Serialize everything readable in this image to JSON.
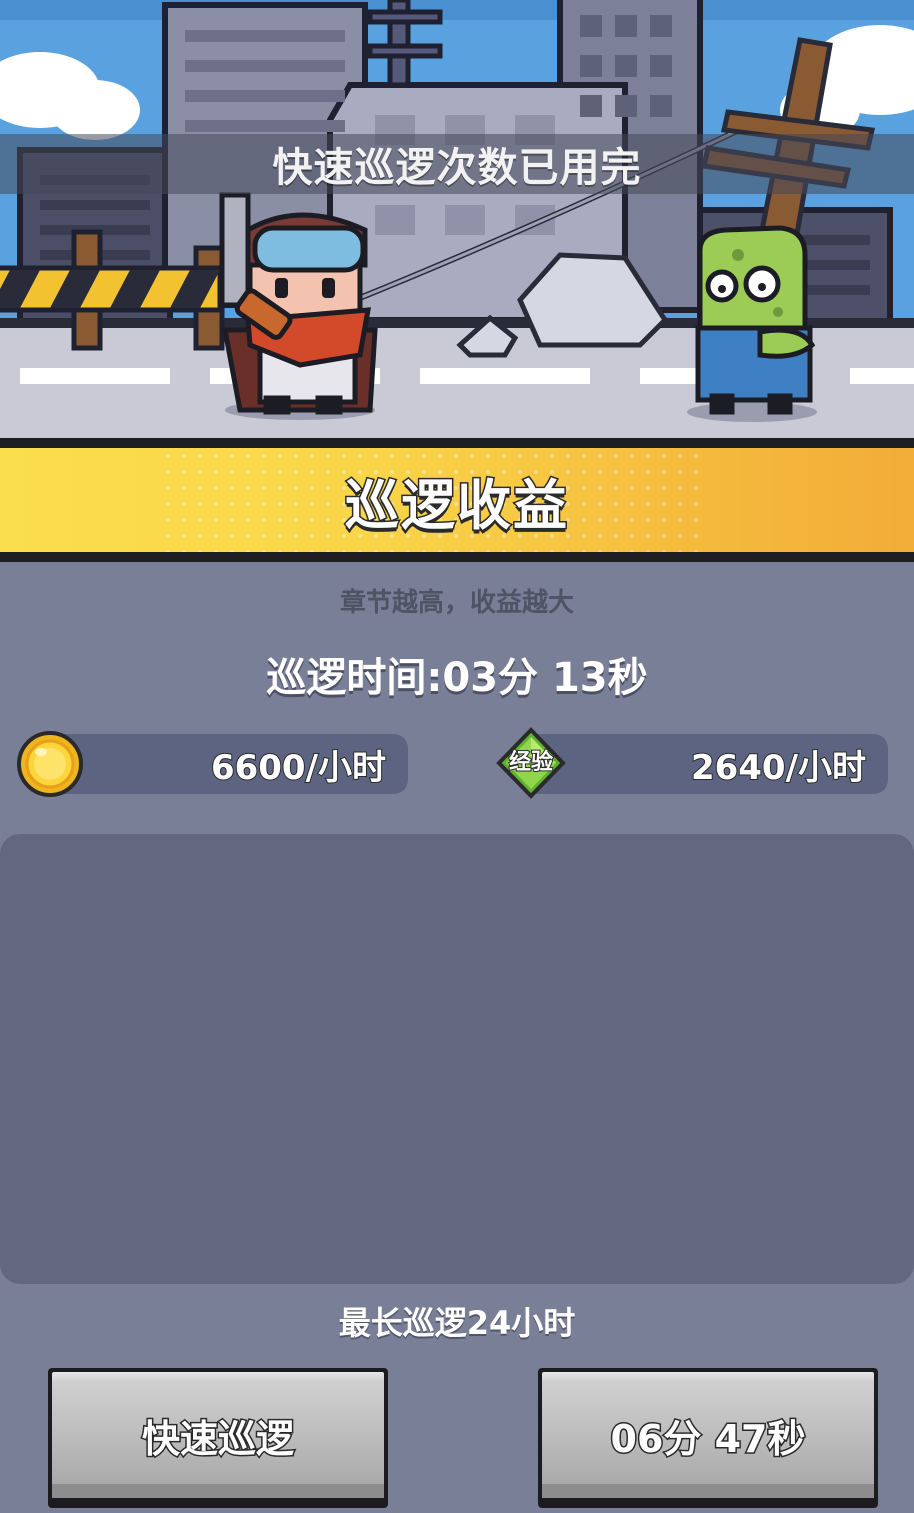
{
  "scene": {
    "banner_text": "快速巡逻次数已用完"
  },
  "header": {
    "title": "巡逻收益"
  },
  "info": {
    "subtitle": "章节越高，收益越大",
    "patrol_time": "巡逻时间:03分 13秒"
  },
  "rates": {
    "gold_rate": "6600/小时",
    "exp_label": "经验",
    "exp_rate": "2640/小时"
  },
  "footer": {
    "max_note": "最长巡逻24小时",
    "quick_patrol_label": "快速巡逻",
    "countdown_label": "06分 47秒"
  },
  "icons": {
    "coin": "gold-coin-icon",
    "exp": "exp-diamond-icon"
  },
  "colors": {
    "title_bar_yellow": "#fbde4c",
    "title_bar_orange": "#f2ac38",
    "panel_bg": "#7a7f98",
    "reward_panel": "#636880",
    "button_gray": "#bdbdbd"
  }
}
